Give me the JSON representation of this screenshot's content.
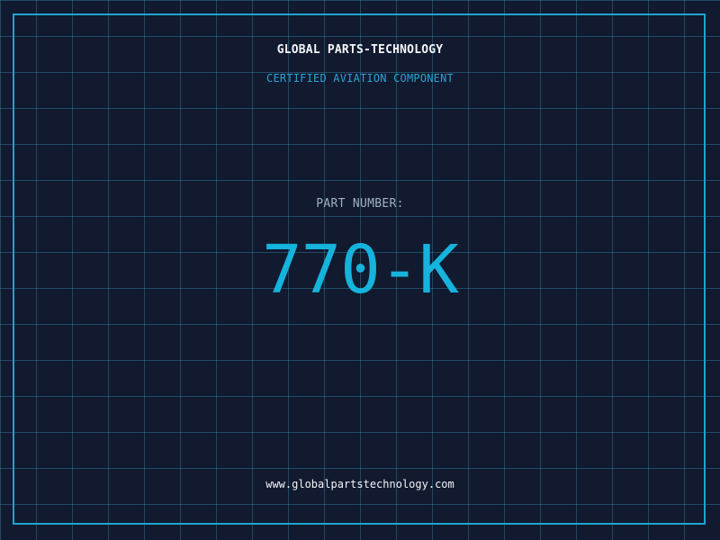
{
  "brand": {
    "title": "GLOBAL PARTS-TECHNOLOGY",
    "subtitle": "CERTIFIED AVIATION COMPONENT"
  },
  "part": {
    "label": "PART NUMBER:",
    "number": "770-K"
  },
  "footer": {
    "website": "www.globalpartstechnology.com"
  },
  "colors": {
    "background": "#111a2f",
    "grid": "#388eaa",
    "frame": "#1fa4cf",
    "accent": "#16b3dc",
    "title": "#f4f6f8",
    "label": "#9fb0c2"
  }
}
